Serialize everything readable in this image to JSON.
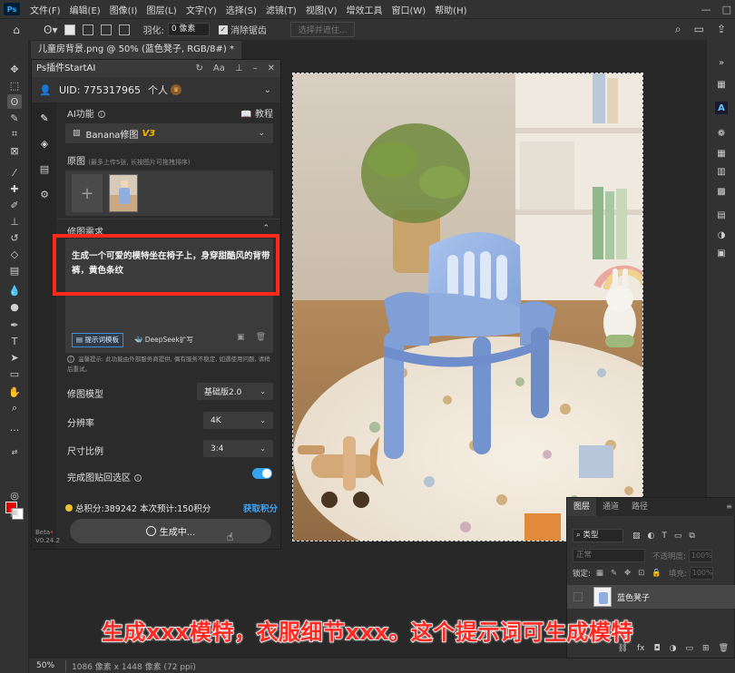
{
  "menu": {
    "items": [
      "文件(F)",
      "编辑(E)",
      "图像(I)",
      "图层(L)",
      "文字(Y)",
      "选择(S)",
      "滤镜(T)",
      "视图(V)",
      "增效工具",
      "窗口(W)",
      "帮助(H)"
    ]
  },
  "options": {
    "feather_label": "羽化:",
    "feather_value": "0 像素",
    "antialias_label": "消除锯齿",
    "select_subject": "选择并遮住..."
  },
  "document": {
    "tab_title": "儿童房背景.png @ 50% (蓝色凳子, RGB/8#) *",
    "zoom": "50%",
    "info": "1086 像素 x 1448 像素 (72 ppi)"
  },
  "plugin": {
    "title": "Ps插件StartAI",
    "uid": "UID: 775317965",
    "account_type": "个人",
    "ai_function_label": "AI功能",
    "tutorial_label": "教程",
    "model_name": "Banana修图",
    "model_version": "V3",
    "source_label": "原图",
    "source_hint": "(最多上传5张, 长按图片可拖拽排序)",
    "edit_req_label": "修图需求",
    "prompt_text": "生成一个可爱的模特坐在椅子上，身穿甜酷风的背带裤，黄色条纹",
    "template_btn": "提示词模板",
    "deepseek_btn": "DeepSeek扩写",
    "notice": "温馨提示: 此功能由外部服务商提供, 偶有服务不稳定, 如遇使用问题, 请稍后重试。",
    "model_label": "修图模型",
    "model_value": "基础版2.0",
    "resolution_label": "分辨率",
    "resolution_value": "4K",
    "ratio_label": "尺寸比例",
    "ratio_value": "3:4",
    "paste_back_label": "完成图贴回选区",
    "paste_back_enabled": true,
    "credits_text": "总积分:389242  本次预计:150积分",
    "get_credits": "获取积分",
    "generate_btn": "生成中...",
    "beta_label": "Beta",
    "version": "V0.24.2"
  },
  "layers": {
    "tabs": [
      "图层",
      "通道",
      "路径"
    ],
    "filter_type": "类型",
    "blend_mode": "正常",
    "opacity_label": "不透明度:",
    "opacity_value": "100%",
    "lock_label": "锁定:",
    "fill_label": "填充:",
    "fill_value": "100%",
    "layer_name": "蓝色凳子"
  },
  "subtitle": "生成xxx模特，衣服细节xxx。这个提示词可生成模特",
  "colors": {
    "accent_blue": "#35a4ef",
    "red_highlight": "#ff2a1a",
    "foreground": "#e60000",
    "background": "#ffffff"
  }
}
